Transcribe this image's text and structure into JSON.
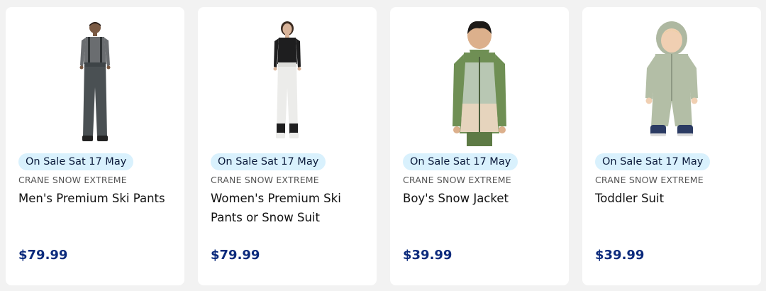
{
  "products": [
    {
      "badge": "On Sale Sat 17 May",
      "brand": "CRANE SNOW EXTREME",
      "title": "Men's Premium Ski Pants",
      "price": "$79.99",
      "image": "man-ski-pants-image"
    },
    {
      "badge": "On Sale Sat 17 May",
      "brand": "CRANE SNOW EXTREME",
      "title": "Women's Premium Ski Pants or Snow Suit",
      "price": "$79.99",
      "image": "woman-ski-pants-image"
    },
    {
      "badge": "On Sale Sat 17 May",
      "brand": "CRANE SNOW EXTREME",
      "title": "Boy's Snow Jacket",
      "price": "$39.99",
      "image": "boy-snow-jacket-image"
    },
    {
      "badge": "On Sale Sat 17 May",
      "brand": "CRANE SNOW EXTREME",
      "title": "Toddler Suit",
      "price": "$39.99",
      "image": "toddler-suit-image"
    }
  ],
  "colors": {
    "badge_bg": "#d9f1fd",
    "price": "#0b2a7c",
    "page_bg": "#f2f2f2"
  }
}
